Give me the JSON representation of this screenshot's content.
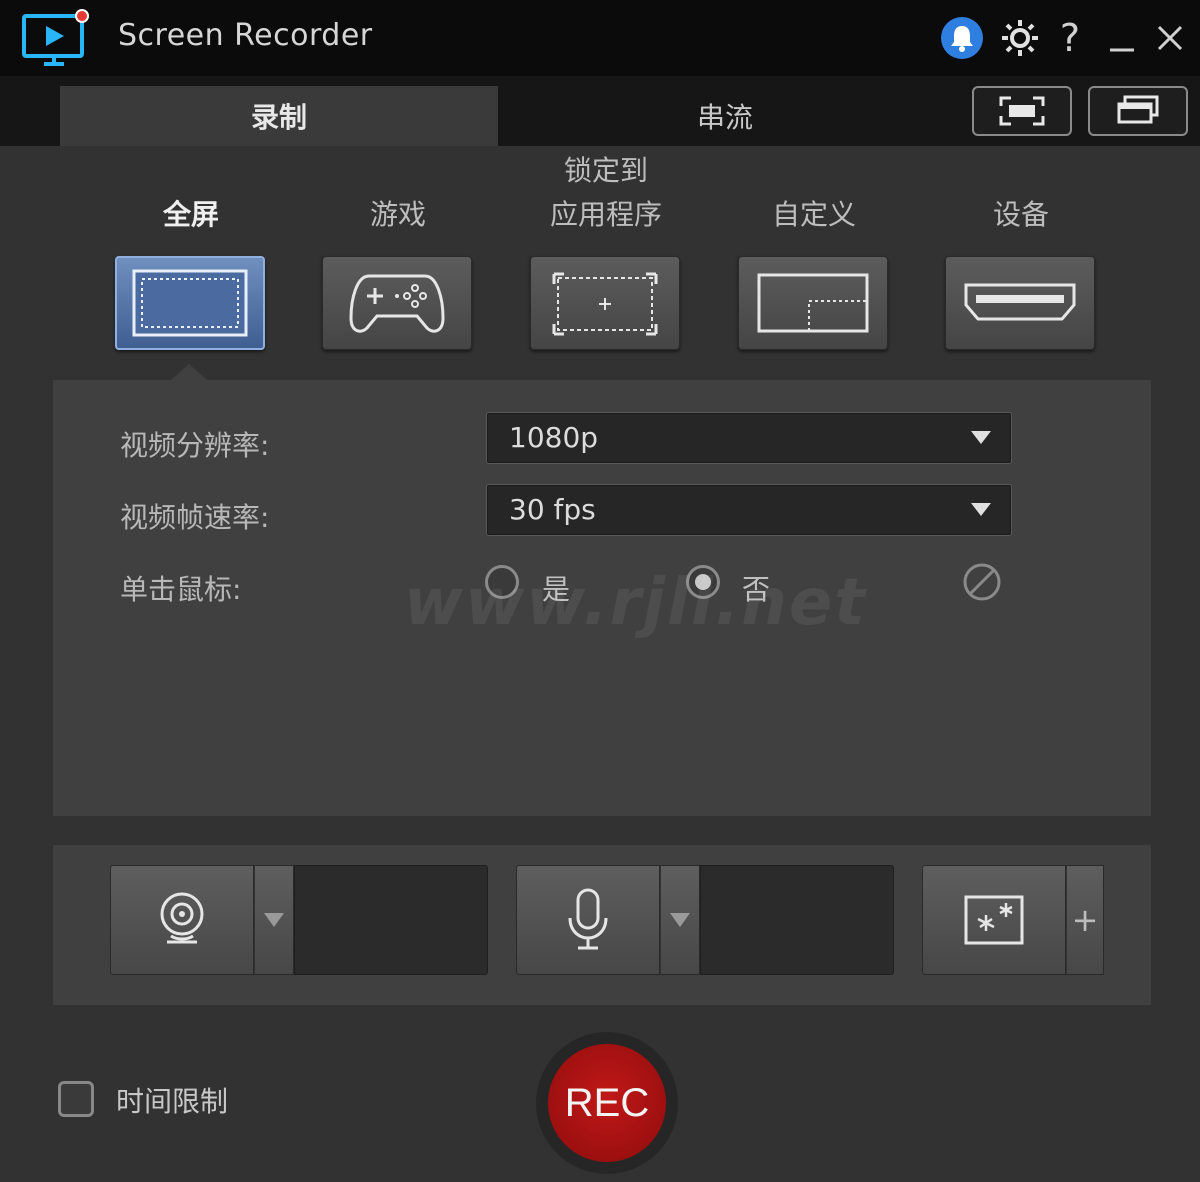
{
  "app": {
    "title": "Screen Recorder",
    "icons": [
      "app-logo-icon",
      "notification-bell-icon",
      "gear-icon",
      "help-icon",
      "minimize-icon",
      "close-icon"
    ]
  },
  "tabs": {
    "record": "录制",
    "stream": "串流"
  },
  "modes": [
    {
      "label": "全屏",
      "icon": "fullscreen-icon",
      "active": true
    },
    {
      "label": "游戏",
      "icon": "gamepad-icon"
    },
    {
      "label_line1": "锁定到",
      "label_line2": "应用程序",
      "icon": "lock-to-app-icon"
    },
    {
      "label": "自定义",
      "icon": "custom-area-icon"
    },
    {
      "label": "设备",
      "icon": "hdmi-device-icon"
    }
  ],
  "settings": {
    "resolution_label": "视频分辨率:",
    "resolution_value": "1080p",
    "framerate_label": "视频帧速率:",
    "framerate_value": "30 fps",
    "mouse_click_label": "单击鼠标:",
    "option_yes": "是",
    "option_no": "否",
    "selected": "否"
  },
  "watermark": "www.rjll.net",
  "devices": {
    "webcam_icon": "webcam-icon",
    "mic_icon": "microphone-icon",
    "effects_icon": "effects-icon",
    "add_label": "+"
  },
  "footer": {
    "time_limit_label": "时间限制",
    "rec_label": "REC"
  },
  "colors": {
    "rec": "#a81212",
    "active_mode": "#4f6fa5",
    "bell": "#2f7fe0",
    "logo": "#29b6f6"
  }
}
